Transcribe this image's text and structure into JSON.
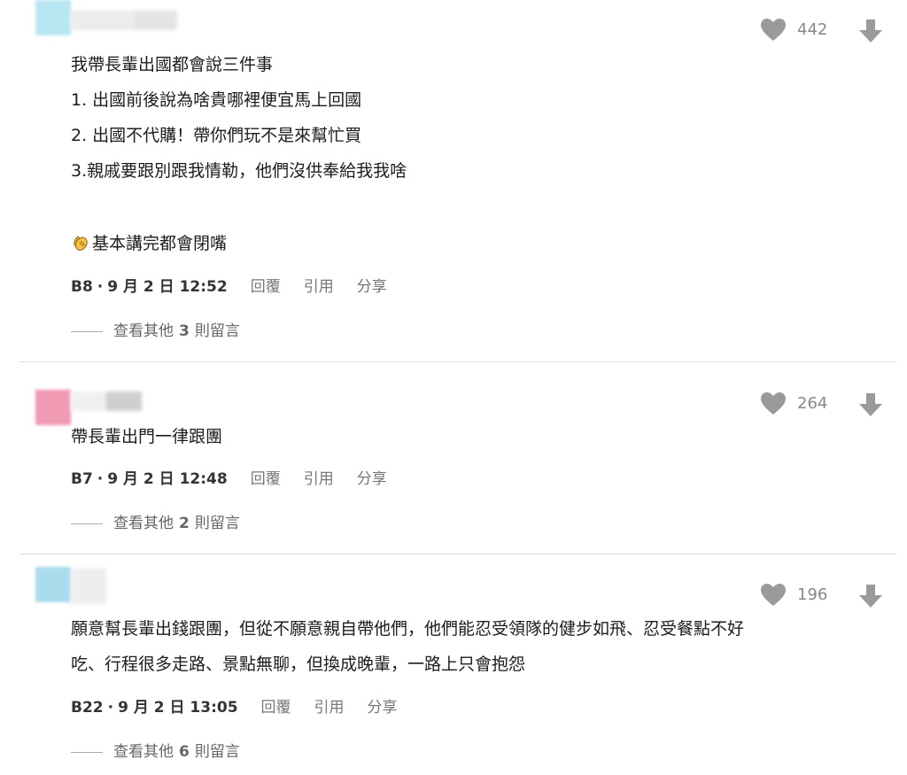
{
  "comments": [
    {
      "floor": "B8",
      "date": "9 月 2 日 12:52",
      "likes": "442",
      "lines": [
        "我帶長輩出國都會說三件事",
        "1. 出國前後說為啥貴哪裡便宜馬上回國",
        "2. 出國不代購！帶你們玩不是來幫忙買",
        "3.親戚要跟別跟我情勒，他們沒供奉給我我啥",
        "基本講完都會閉嘴"
      ],
      "reply_prefix": "查看其他",
      "reply_count": "3",
      "reply_suffix": "則留言",
      "avatar_color": "#b8e6f2"
    },
    {
      "floor": "B7",
      "date": "9 月 2 日 12:48",
      "likes": "264",
      "lines": [
        "帶長輩出門一律跟團"
      ],
      "reply_prefix": "查看其他",
      "reply_count": "2",
      "reply_suffix": "則留言",
      "avatar_color": "#f09ab4"
    },
    {
      "floor": "B22",
      "date": "9 月 2 日 13:05",
      "likes": "196",
      "lines": [
        "願意幫長輩出錢跟團，但從不願意親自帶他們，他們能忍受領隊的健步如飛、忍受餐點不好",
        "吃、行程很多走路、景點無聊，但換成晚輩，一路上只會抱怨"
      ],
      "reply_prefix": "查看其他",
      "reply_count": "6",
      "reply_suffix": "則留言",
      "avatar_color": "#a9dcec"
    }
  ],
  "actions": {
    "reply": "回覆",
    "quote": "引用",
    "share": "分享"
  },
  "icons": {
    "like": "heart-icon",
    "down": "arrow-down-icon",
    "emoji": "clapping-hands-icon"
  },
  "colors": {
    "icon_gray": "#9a9a9a",
    "divider": "#dedede"
  }
}
